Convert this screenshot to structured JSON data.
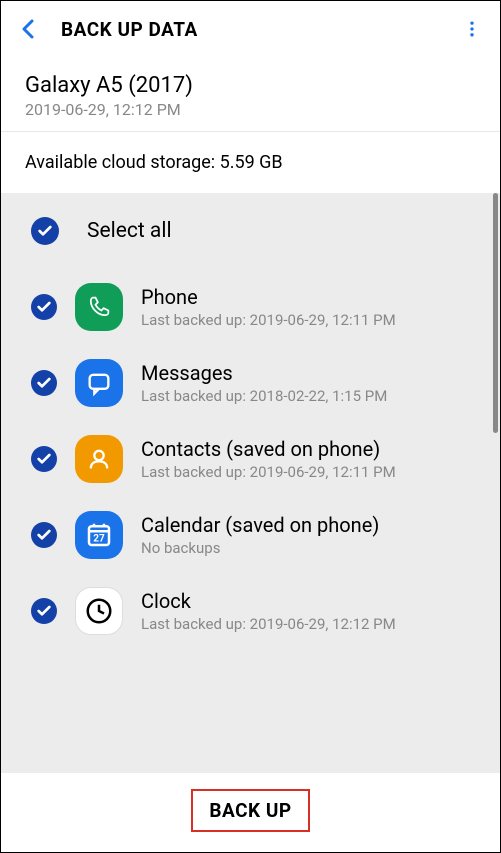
{
  "header": {
    "title": "BACK UP DATA"
  },
  "device": {
    "name": "Galaxy A5 (2017)",
    "date": "2019-06-29, 12:12 PM"
  },
  "storage": {
    "text": "Available cloud storage: 5.59 GB"
  },
  "select_all": {
    "label": "Select all"
  },
  "items": [
    {
      "title": "Phone",
      "subtitle": "Last backed up: 2019-06-29, 12:11 PM",
      "icon": "phone"
    },
    {
      "title": "Messages",
      "subtitle": "Last backed up: 2018-02-22, 1:15 PM",
      "icon": "messages"
    },
    {
      "title": "Contacts (saved on phone)",
      "subtitle": "Last backed up: 2019-06-29, 12:11 PM",
      "icon": "contacts"
    },
    {
      "title": "Calendar (saved on phone)",
      "subtitle": "No backups",
      "icon": "calendar"
    },
    {
      "title": "Clock",
      "subtitle": "Last backed up: 2019-06-29, 12:12 PM",
      "icon": "clock"
    }
  ],
  "footer": {
    "button": "BACK UP"
  }
}
